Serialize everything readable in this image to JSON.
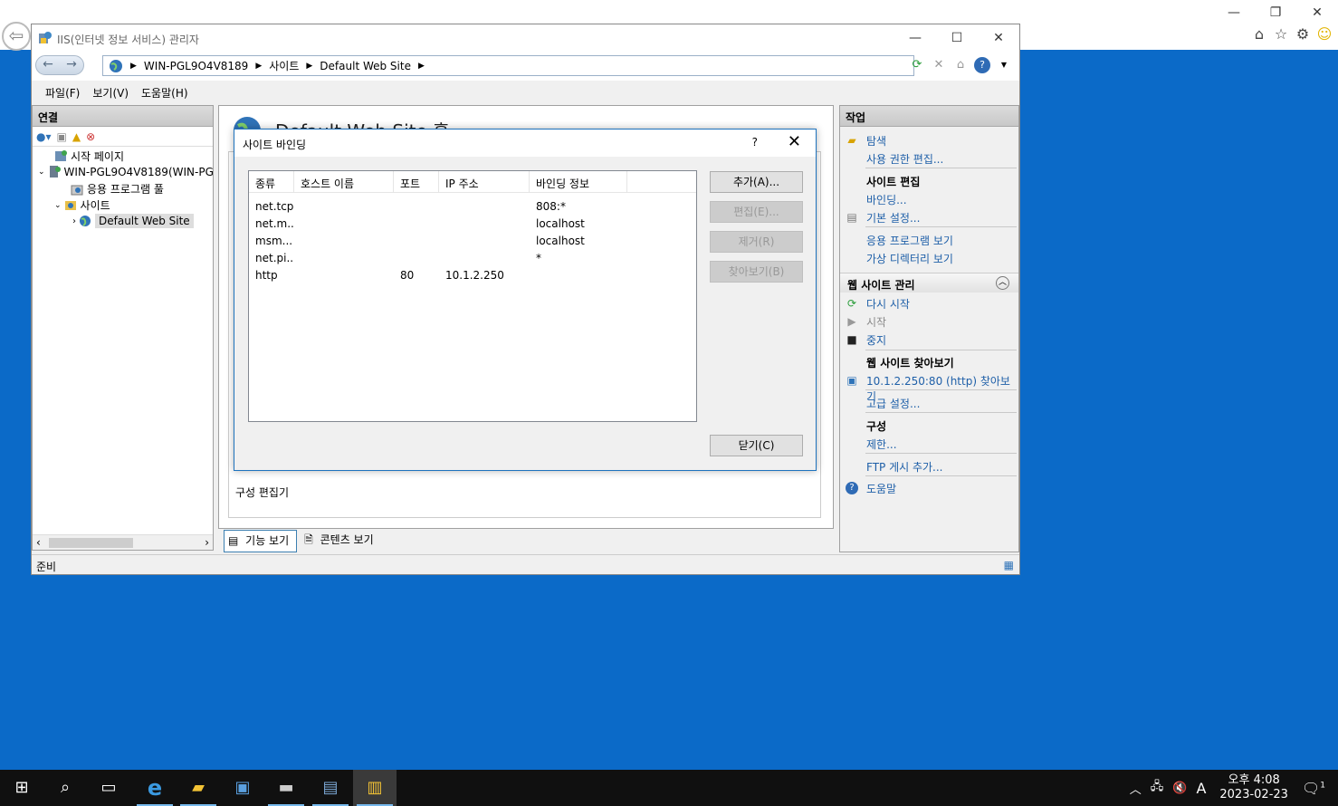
{
  "window": {
    "title": "IIS(인터넷 정보 서비스) 관리자",
    "min": "—",
    "max": "☐",
    "close": "✕"
  },
  "address": {
    "crumbs": [
      "WIN-PGL9O4V8189",
      "사이트",
      "Default Web Site"
    ]
  },
  "menu": [
    "파일(F)",
    "보기(V)",
    "도움말(H)"
  ],
  "connections": {
    "title": "연결",
    "tree": [
      {
        "label": "시작 페이지"
      },
      {
        "label": "WIN-PGL9O4V8189(WIN-PG"
      },
      {
        "label": "응용 프로그램 풀"
      },
      {
        "label": "사이트"
      },
      {
        "label": "Default Web Site"
      }
    ]
  },
  "center": {
    "page_title": "Default Web Site 홈",
    "group_label": "구성 편집기",
    "tab_features": "기능 보기",
    "tab_content": "콘텐츠 보기"
  },
  "actions": {
    "title": "작업",
    "explore": "탐색",
    "edit_permissions": "사용 권한 편집...",
    "edit_site": "사이트 편집",
    "bindings": "바인딩...",
    "basic_settings": "기본 설정...",
    "view_apps": "응용 프로그램 보기",
    "view_vdirs": "가상 디렉터리 보기",
    "manage_site": "웹 사이트 관리",
    "restart": "다시 시작",
    "start": "시작",
    "stop": "중지",
    "browse_site": "웹 사이트 찾아보기",
    "browse_link": "10.1.2.250:80 (http) 찾아보기",
    "advanced": "고급 설정...",
    "config": "구성",
    "limits": "제한...",
    "ftp": "FTP 게시 추가...",
    "help": "도움말"
  },
  "status": {
    "text": "준비"
  },
  "dialog": {
    "title": "사이트 바인딩",
    "help": "?",
    "columns": [
      "종류",
      "호스트 이름",
      "포트",
      "IP 주소",
      "바인딩 정보"
    ],
    "rows": [
      [
        "net.tcp",
        "",
        "",
        "",
        "808:*"
      ],
      [
        "net.m...",
        "",
        "",
        "",
        "localhost"
      ],
      [
        "msm...",
        "",
        "",
        "",
        "localhost"
      ],
      [
        "net.pi...",
        "",
        "",
        "",
        "*"
      ],
      [
        "http",
        "",
        "80",
        "10.1.2.250",
        ""
      ]
    ],
    "buttons": {
      "add": "추가(A)...",
      "edit": "편집(E)...",
      "remove": "제거(R)",
      "browse": "찾아보기(B)",
      "close": "닫기(C)"
    }
  },
  "taskbar": {
    "time": "오후 4:08",
    "date": "2023-02-23",
    "ime": "A",
    "notif": "1"
  }
}
